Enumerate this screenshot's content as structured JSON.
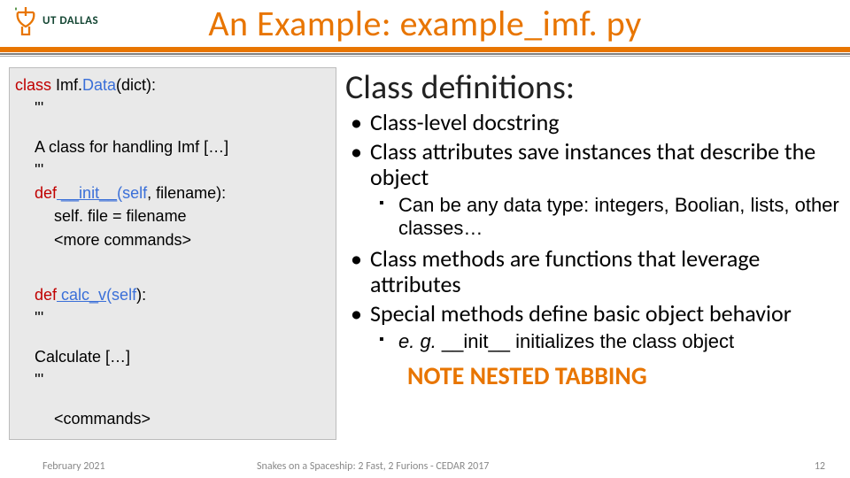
{
  "header": {
    "logo_text": "UT DALLAS",
    "title": "An Example: example_imf. py"
  },
  "code": {
    "l1a": "class",
    "l1b": " Imf.",
    "l1c": "Data",
    "l1d": "(dict):",
    "l2": "'''",
    "l3": "A class for handling Imf […]",
    "l4": "'''",
    "l5a": "def",
    "l5b": " __init__",
    "l5c": "(self",
    "l5d": ", filename):",
    "l6": "self. file = filename",
    "l7": "<more commands>",
    "l8a": "def",
    "l8b": " calc_v",
    "l8c": "(self",
    "l8d": "):",
    "l9": "'''",
    "l10": "Calculate […]",
    "l11": "'''",
    "l12": "<commands>"
  },
  "right": {
    "heading": "Class definitions:",
    "b1": "Class-level docstring",
    "b2": "Class attributes save instances that describe the object",
    "b2a": "Can be any data type: integers, Boolian, lists, other classes…",
    "b3": "Class methods are functions that leverage attributes",
    "b4": "Special methods define basic object behavior",
    "b4a_em": "e. g. ",
    "b4a_rest": "__init__ initializes the class object",
    "note": "NOTE NESTED TABBING"
  },
  "footer": {
    "date": "February 2021",
    "mid": "Snakes on a Spaceship: 2 Fast, 2 Furions - CEDAR 2017",
    "page": "12"
  }
}
